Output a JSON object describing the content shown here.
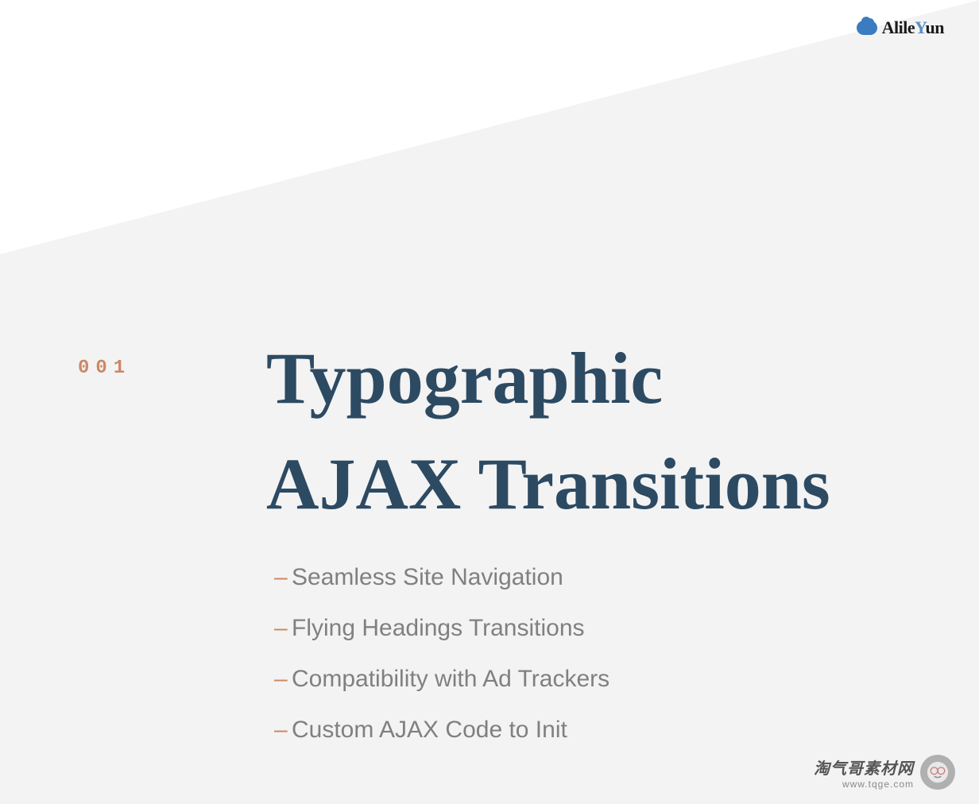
{
  "brand": {
    "name_part1": "Alile",
    "name_part2": "Y",
    "name_part3": "un"
  },
  "slide_number": "001",
  "title_line1": "Typographic",
  "title_line2": "AJAX Transitions",
  "features": [
    "Seamless Site Navigation",
    "Flying Headings Transitions",
    "Compatibility with Ad Trackers",
    "Custom AJAX Code to Init"
  ],
  "watermark": {
    "title": "淘气哥素材网",
    "url": "www.tqge.com"
  }
}
